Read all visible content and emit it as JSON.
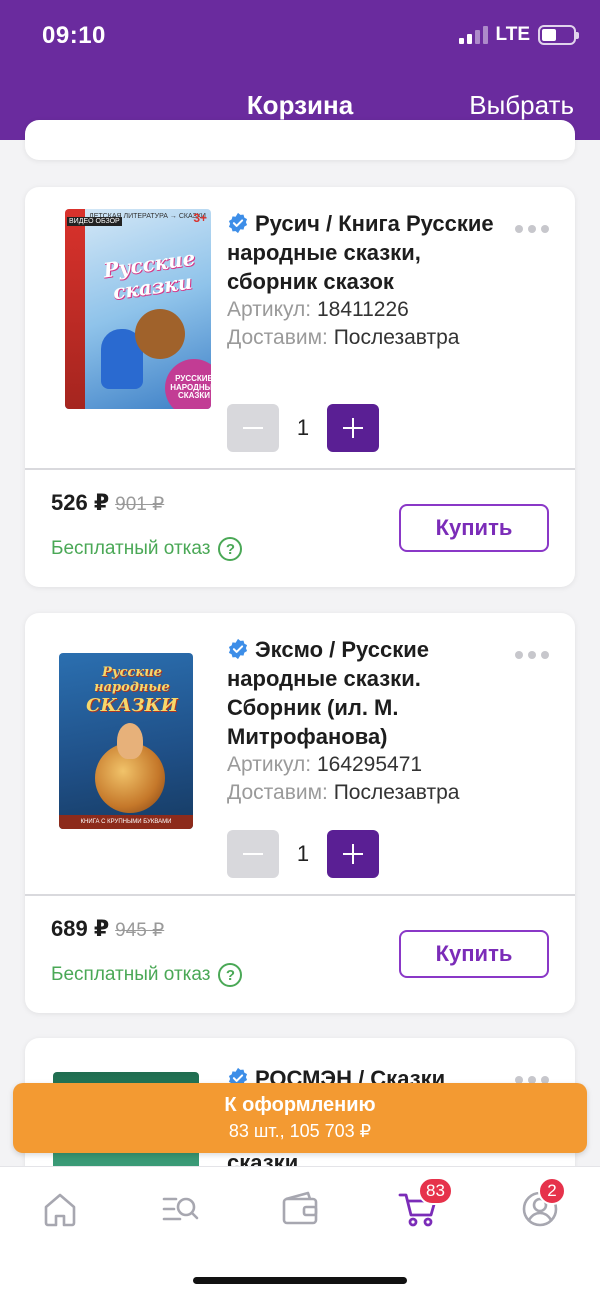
{
  "status_bar": {
    "time": "09:10",
    "network": "LTE"
  },
  "header": {
    "title": "Корзина",
    "action": "Выбрать"
  },
  "labels": {
    "article": "Артикул:",
    "delivery": "Доставим:"
  },
  "items": [
    {
      "name": "Русич / Книга Русские народные сказки, сборник сказок",
      "article": "18411226",
      "delivery": "Послезавтра",
      "quantity": "1",
      "price": "526 ₽",
      "old_price": "901 ₽",
      "refund": "Бесплатный отказ",
      "buy": "Купить",
      "cover": {
        "top_line": "ДЕТСКАЯ ЛИТЕРАТУРА → СКАЗКИ",
        "age": "3+",
        "video": "ВИДЕО ОБЗОР",
        "title": "Русские сказки",
        "badge": "РУССКИЕ НАРОДНЫЕ СКАЗКИ"
      }
    },
    {
      "name": "Эксмо / Русские народные сказки. Сборник (ил. М. Митрофанова)",
      "article": "164295471",
      "delivery": "Послезавтра",
      "quantity": "1",
      "price": "689 ₽",
      "old_price": "945 ₽",
      "refund": "Бесплатный отказ",
      "buy": "Купить",
      "cover": {
        "title_line1": "Русские народные",
        "title_line2": "СКАЗКИ",
        "strip": "КНИГА С КРУПНЫМИ БУКВАМИ"
      }
    },
    {
      "name": "РОСМЭН / Сказки",
      "name_tail": "сказки"
    }
  ],
  "checkout": {
    "label": "К оформлению",
    "summary": "83 шт., 105 703 ₽"
  },
  "tabbar": {
    "cart_count": "83",
    "profile_count": "2"
  },
  "colors": {
    "brand": "#6a2b9e",
    "plus": "#5a1f94",
    "checkout": "#f39a32",
    "success": "#4aa856",
    "badge": "#e6324b"
  }
}
